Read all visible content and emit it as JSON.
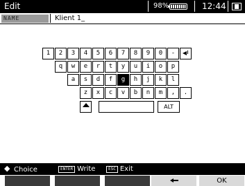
{
  "window": {
    "title": "Edit"
  },
  "status": {
    "battery_percent": "98%",
    "time": "12:44"
  },
  "name_field": {
    "label": "NAME",
    "value": "Klient 1_"
  },
  "keyboard": {
    "row1": [
      "1",
      "2",
      "3",
      "4",
      "5",
      "6",
      "7",
      "8",
      "9",
      "0",
      "-"
    ],
    "row2": [
      "q",
      "w",
      "e",
      "r",
      "t",
      "y",
      "u",
      "i",
      "o",
      "p"
    ],
    "row3": [
      "a",
      "s",
      "d",
      "f",
      "g",
      "h",
      "j",
      "k",
      "l"
    ],
    "row4": [
      "z",
      "x",
      "c",
      "v",
      "b",
      "n",
      "m",
      ",",
      "."
    ],
    "alt_label": "ALT",
    "selected_key": "g"
  },
  "help": {
    "choice_label": "Choice",
    "enter_key": "ENTER",
    "write_label": "Write",
    "esc_key": "ESC",
    "exit_label": "Exit"
  },
  "softkeys": {
    "ok_label": "OK"
  },
  "icons": [
    "battery-icon",
    "signal-icon",
    "enter-icon",
    "shift-icon",
    "dpad-icon",
    "arrow-left-icon"
  ],
  "colors": {
    "bar": "#000000",
    "label_bg": "#9a9a9a",
    "softkey_dark": "#3a3a3a",
    "softkey_light": "#d9d9d9"
  }
}
